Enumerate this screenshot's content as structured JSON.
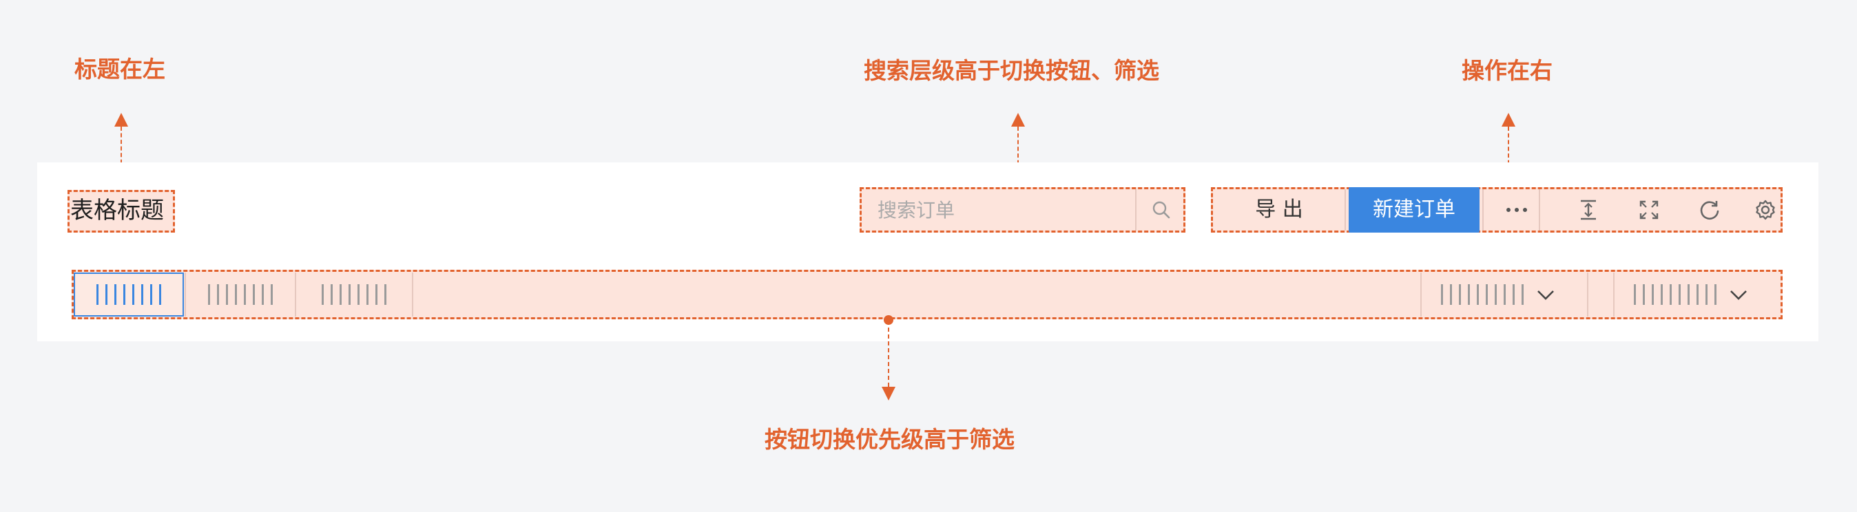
{
  "annotations": {
    "title_left": "标题在左",
    "search_priority": "搜索层级高于切换按钮、筛选",
    "actions_right": "操作在右",
    "toggle_priority": "按钮切换优先级高于筛选"
  },
  "header": {
    "title": "表格标题",
    "search_placeholder": "搜索订单",
    "export_label": "导 出",
    "new_order_label": "新建订单"
  },
  "icons": {
    "search": "search-icon",
    "more": "more-icon",
    "row_height": "row-height-icon",
    "fullscreen": "fullscreen-icon",
    "refresh": "refresh-icon",
    "settings": "gear-icon",
    "dropdown": "chevron-down-icon"
  },
  "tabs": [
    {
      "active": true
    },
    {
      "active": false
    },
    {
      "active": false
    }
  ],
  "colors": {
    "annotation": "#e2622e",
    "highlight_fill": "#fde4dc",
    "primary": "#3a86e0",
    "title_text": "#1f1f1f"
  }
}
